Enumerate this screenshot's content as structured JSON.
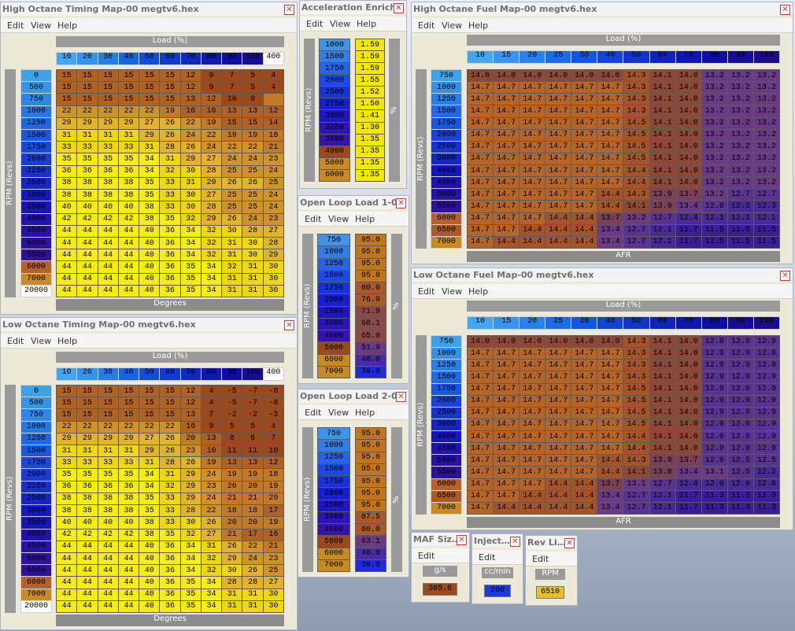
{
  "menu": {
    "edit": "Edit",
    "view": "View",
    "help": "Help"
  },
  "windows": {
    "hot": {
      "title": "High Octane Timing Map-00 megtv6.hex",
      "xlabel": "Load (%)",
      "ylabel": "RPM (Revs)",
      "footer": "Degrees",
      "cols": [
        "10",
        "20",
        "30",
        "40",
        "50",
        "60",
        "70",
        "80",
        "90",
        "100",
        "400"
      ],
      "rows": [
        "0",
        "500",
        "750",
        "1000",
        "1250",
        "1500",
        "1750",
        "2000",
        "2250",
        "2500",
        "3000",
        "3500",
        "4000",
        "4500",
        "5000",
        "5500",
        "6000",
        "7000",
        "20000"
      ],
      "cells": [
        [
          "15",
          "15",
          "15",
          "15",
          "15",
          "15",
          "12",
          "9",
          "7",
          "5",
          "4"
        ],
        [
          "15",
          "15",
          "15",
          "15",
          "15",
          "15",
          "12",
          "9",
          "7",
          "5",
          "4"
        ],
        [
          "15",
          "15",
          "15",
          "15",
          "15",
          "15",
          "13",
          "12",
          "10",
          "9"
        ],
        [
          "22",
          "22",
          "22",
          "22",
          "22",
          "19",
          "16",
          "16",
          "13",
          "13",
          "12"
        ],
        [
          "29",
          "29",
          "29",
          "29",
          "27",
          "26",
          "22",
          "19",
          "15",
          "15",
          "14"
        ],
        [
          "31",
          "31",
          "31",
          "31",
          "29",
          "26",
          "24",
          "22",
          "19",
          "19",
          "18"
        ],
        [
          "33",
          "33",
          "33",
          "33",
          "31",
          "28",
          "26",
          "24",
          "22",
          "22",
          "21"
        ],
        [
          "35",
          "35",
          "35",
          "35",
          "34",
          "31",
          "29",
          "27",
          "24",
          "24",
          "23"
        ],
        [
          "36",
          "36",
          "36",
          "36",
          "34",
          "32",
          "30",
          "28",
          "25",
          "25",
          "24"
        ],
        [
          "38",
          "38",
          "38",
          "38",
          "35",
          "33",
          "31",
          "29",
          "26",
          "26",
          "25"
        ],
        [
          "38",
          "38",
          "38",
          "38",
          "35",
          "33",
          "30",
          "27",
          "25",
          "25",
          "24"
        ],
        [
          "40",
          "40",
          "40",
          "40",
          "38",
          "33",
          "30",
          "28",
          "25",
          "25",
          "24"
        ],
        [
          "42",
          "42",
          "42",
          "42",
          "38",
          "35",
          "32",
          "29",
          "26",
          "24",
          "23"
        ],
        [
          "44",
          "44",
          "44",
          "44",
          "40",
          "36",
          "34",
          "32",
          "30",
          "28",
          "27"
        ],
        [
          "44",
          "44",
          "44",
          "44",
          "40",
          "36",
          "34",
          "32",
          "31",
          "30",
          "28"
        ],
        [
          "44",
          "44",
          "44",
          "44",
          "40",
          "36",
          "34",
          "32",
          "31",
          "30",
          "29"
        ],
        [
          "44",
          "44",
          "44",
          "44",
          "40",
          "36",
          "35",
          "34",
          "32",
          "31",
          "30"
        ],
        [
          "44",
          "44",
          "44",
          "44",
          "40",
          "36",
          "35",
          "34",
          "31",
          "31",
          "30"
        ],
        [
          "44",
          "44",
          "44",
          "44",
          "40",
          "36",
          "35",
          "34",
          "31",
          "31",
          "30"
        ]
      ]
    },
    "lot": {
      "title": "Low Octane Timing Map-00 megtv6.hex",
      "xlabel": "Load (%)",
      "ylabel": "RPM (Revs)",
      "footer": "Degrees",
      "cols": [
        "10",
        "20",
        "30",
        "40",
        "50",
        "60",
        "70",
        "80",
        "90",
        "100",
        "400"
      ],
      "rows": [
        "0",
        "500",
        "750",
        "1000",
        "1250",
        "1500",
        "1750",
        "2000",
        "2250",
        "2500",
        "3000",
        "3500",
        "4000",
        "4500",
        "5000",
        "5500",
        "6000",
        "7000",
        "20000"
      ],
      "cells": [
        [
          "15",
          "15",
          "15",
          "15",
          "15",
          "15",
          "12",
          "4",
          "-5",
          "-7",
          "-8"
        ],
        [
          "15",
          "15",
          "15",
          "15",
          "15",
          "15",
          "12",
          "4",
          "-5",
          "-7",
          "-8"
        ],
        [
          "15",
          "15",
          "15",
          "15",
          "15",
          "15",
          "13",
          "7",
          "-2",
          "-2",
          "-3"
        ],
        [
          "22",
          "22",
          "22",
          "22",
          "22",
          "22",
          "16",
          "9",
          "5",
          "5",
          "4"
        ],
        [
          "29",
          "29",
          "29",
          "29",
          "27",
          "26",
          "20",
          "13",
          "8",
          "8",
          "7"
        ],
        [
          "31",
          "31",
          "31",
          "31",
          "29",
          "26",
          "23",
          "16",
          "11",
          "11",
          "10"
        ],
        [
          "33",
          "33",
          "33",
          "33",
          "31",
          "28",
          "26",
          "19",
          "13",
          "13",
          "12"
        ],
        [
          "35",
          "35",
          "35",
          "35",
          "34",
          "31",
          "29",
          "24",
          "19",
          "19",
          "18"
        ],
        [
          "36",
          "36",
          "36",
          "36",
          "34",
          "32",
          "29",
          "23",
          "20",
          "20",
          "19"
        ],
        [
          "38",
          "38",
          "38",
          "38",
          "35",
          "33",
          "29",
          "24",
          "21",
          "21",
          "20"
        ],
        [
          "38",
          "38",
          "38",
          "38",
          "35",
          "33",
          "28",
          "22",
          "18",
          "18",
          "17"
        ],
        [
          "40",
          "40",
          "40",
          "40",
          "38",
          "33",
          "30",
          "26",
          "20",
          "20",
          "19"
        ],
        [
          "42",
          "42",
          "42",
          "42",
          "38",
          "35",
          "32",
          "27",
          "21",
          "17",
          "16"
        ],
        [
          "44",
          "44",
          "44",
          "44",
          "40",
          "36",
          "34",
          "31",
          "26",
          "22",
          "21"
        ],
        [
          "44",
          "44",
          "44",
          "44",
          "40",
          "36",
          "34",
          "32",
          "29",
          "24",
          "23"
        ],
        [
          "44",
          "44",
          "44",
          "44",
          "40",
          "36",
          "34",
          "32",
          "30",
          "26",
          "25"
        ],
        [
          "44",
          "44",
          "44",
          "44",
          "40",
          "36",
          "35",
          "34",
          "28",
          "28",
          "27"
        ],
        [
          "44",
          "44",
          "44",
          "44",
          "40",
          "36",
          "35",
          "34",
          "31",
          "31",
          "30"
        ],
        [
          "44",
          "44",
          "44",
          "44",
          "40",
          "36",
          "35",
          "34",
          "31",
          "31",
          "30"
        ]
      ]
    },
    "ae": {
      "title": "Acceleration Enrich…",
      "ylabel": "RPM (Revs)",
      "unit": "%",
      "rows": [
        "1000",
        "1500",
        "1750",
        "2000",
        "2500",
        "2750",
        "3000",
        "3250",
        "3500",
        "4000",
        "5000",
        "6000"
      ],
      "values": [
        "1.59",
        "1.59",
        "1.59",
        "1.55",
        "1.52",
        "1.50",
        "1.41",
        "1.30",
        "1.35",
        "1.35",
        "1.35",
        "1.35"
      ]
    },
    "ol1": {
      "title": "Open Loop Load 1-0…",
      "ylabel": "RPM (Revs)",
      "unit": "%",
      "rows": [
        "750",
        "1000",
        "1250",
        "1500",
        "1750",
        "2000",
        "2500",
        "3000",
        "4000",
        "5000",
        "6000",
        "7000"
      ],
      "values": [
        "95.0",
        "95.0",
        "95.0",
        "95.0",
        "80.0",
        "76.9",
        "71.9",
        "68.1",
        "65.0",
        "51.9",
        "40.0",
        "30.0"
      ]
    },
    "ol2": {
      "title": "Open Loop Load 2-0…",
      "ylabel": "RPM (Revs)",
      "unit": "%",
      "rows": [
        "750",
        "1000",
        "1250",
        "1500",
        "1750",
        "2000",
        "2500",
        "3000",
        "4000",
        "5000",
        "6000",
        "7000"
      ],
      "values": [
        "95.0",
        "95.0",
        "95.0",
        "95.0",
        "95.0",
        "95.0",
        "95.0",
        "87.5",
        "80.0",
        "63.1",
        "40.0",
        "30.0"
      ]
    },
    "hof": {
      "title": "High Octane Fuel Map-00 megtv6.hex",
      "xlabel": "Load (%)",
      "ylabel": "RPM (Revs)",
      "footer": "AFR",
      "cols": [
        "10",
        "15",
        "20",
        "25",
        "30",
        "40",
        "50",
        "60",
        "70",
        "80",
        "90",
        "100"
      ],
      "rows": [
        "750",
        "1000",
        "1250",
        "1500",
        "1750",
        "2000",
        "2500",
        "3000",
        "4000",
        "4500",
        "5000",
        "5500",
        "6000",
        "6500",
        "7000"
      ],
      "cells": [
        [
          "14.0",
          "14.0",
          "14.0",
          "14.0",
          "14.0",
          "14.0",
          "14.3",
          "14.1",
          "14.0",
          "13.2",
          "13.2",
          "13.2"
        ],
        [
          "14.7",
          "14.7",
          "14.7",
          "14.7",
          "14.7",
          "14.7",
          "14.3",
          "14.1",
          "14.0",
          "13.2",
          "13.2",
          "13.2"
        ],
        [
          "14.7",
          "14.7",
          "14.7",
          "14.7",
          "14.7",
          "14.7",
          "14.3",
          "14.1",
          "14.0",
          "13.2",
          "13.2",
          "13.2"
        ],
        [
          "14.7",
          "14.7",
          "14.7",
          "14.7",
          "14.7",
          "14.7",
          "14.3",
          "14.1",
          "14.0",
          "13.2",
          "13.2",
          "13.2"
        ],
        [
          "14.7",
          "14.7",
          "14.7",
          "14.7",
          "14.7",
          "14.7",
          "14.5",
          "14.1",
          "14.0",
          "13.2",
          "13.2",
          "13.2"
        ],
        [
          "14.7",
          "14.7",
          "14.7",
          "14.7",
          "14.7",
          "14.7",
          "14.5",
          "14.1",
          "14.0",
          "13.2",
          "13.2",
          "13.2"
        ],
        [
          "14.7",
          "14.7",
          "14.7",
          "14.7",
          "14.7",
          "14.7",
          "14.5",
          "14.1",
          "14.0",
          "13.2",
          "13.2",
          "13.2"
        ],
        [
          "14.7",
          "14.7",
          "14.7",
          "14.7",
          "14.7",
          "14.7",
          "14.5",
          "14.1",
          "14.0",
          "13.2",
          "13.2",
          "13.2"
        ],
        [
          "14.7",
          "14.7",
          "14.7",
          "14.7",
          "14.7",
          "14.7",
          "14.4",
          "14.1",
          "14.0",
          "13.2",
          "13.2",
          "13.2"
        ],
        [
          "14.7",
          "14.7",
          "14.7",
          "14.7",
          "14.7",
          "14.7",
          "14.4",
          "14.1",
          "14.0",
          "13.2",
          "13.2",
          "13.2"
        ],
        [
          "14.7",
          "14.7",
          "14.7",
          "14.7",
          "14.7",
          "14.4",
          "14.3",
          "13.9",
          "13.7",
          "13.2",
          "12.7",
          "12.7"
        ],
        [
          "14.7",
          "14.7",
          "14.7",
          "14.7",
          "14.7",
          "14.4",
          "14.1",
          "13.9",
          "13.4",
          "12.6",
          "12.3",
          "12.3"
        ],
        [
          "14.7",
          "14.7",
          "14.7",
          "14.4",
          "14.4",
          "13.7",
          "13.2",
          "12.7",
          "12.4",
          "12.1",
          "12.1",
          "12.1"
        ],
        [
          "14.7",
          "14.7",
          "14.4",
          "14.4",
          "14.4",
          "13.4",
          "12.7",
          "12.1",
          "11.7",
          "11.5",
          "11.5",
          "11.5"
        ],
        [
          "14.7",
          "14.4",
          "14.4",
          "14.4",
          "14.4",
          "13.4",
          "12.7",
          "12.1",
          "11.7",
          "11.5",
          "11.5",
          "11.5"
        ]
      ]
    },
    "lof": {
      "title": "Low Octane Fuel Map-00 megtv6.hex",
      "xlabel": "Load (%)",
      "ylabel": "RPM (Revs)",
      "footer": "AFR",
      "cols": [
        "10",
        "15",
        "20",
        "25",
        "30",
        "40",
        "50",
        "60",
        "70",
        "80",
        "90",
        "100"
      ],
      "rows": [
        "750",
        "1000",
        "1250",
        "1500",
        "1750",
        "2000",
        "2500",
        "3000",
        "4000",
        "4500",
        "5000",
        "5500",
        "6000",
        "6500",
        "7000"
      ],
      "cells": [
        [
          "14.0",
          "14.0",
          "14.0",
          "14.0",
          "14.0",
          "14.0",
          "14.3",
          "14.1",
          "14.0",
          "12.9",
          "12.9",
          "12.9"
        ],
        [
          "14.7",
          "14.7",
          "14.7",
          "14.7",
          "14.7",
          "14.7",
          "14.3",
          "14.1",
          "14.0",
          "12.9",
          "12.9",
          "12.9"
        ],
        [
          "14.7",
          "14.7",
          "14.7",
          "14.7",
          "14.7",
          "14.7",
          "14.3",
          "14.1",
          "14.0",
          "12.9",
          "12.9",
          "12.9"
        ],
        [
          "14.7",
          "14.7",
          "14.7",
          "14.7",
          "14.7",
          "14.7",
          "14.3",
          "14.1",
          "14.0",
          "12.9",
          "12.9",
          "12.9"
        ],
        [
          "14.7",
          "14.7",
          "14.7",
          "14.7",
          "14.7",
          "14.7",
          "14.5",
          "14.1",
          "14.0",
          "12.9",
          "12.9",
          "12.9"
        ],
        [
          "14.7",
          "14.7",
          "14.7",
          "14.7",
          "14.7",
          "14.7",
          "14.5",
          "14.1",
          "14.0",
          "12.9",
          "12.9",
          "12.9"
        ],
        [
          "14.7",
          "14.7",
          "14.7",
          "14.7",
          "14.7",
          "14.7",
          "14.5",
          "14.1",
          "14.0",
          "12.9",
          "12.9",
          "12.9"
        ],
        [
          "14.7",
          "14.7",
          "14.7",
          "14.7",
          "14.7",
          "14.7",
          "14.5",
          "14.1",
          "14.0",
          "12.9",
          "12.9",
          "12.9"
        ],
        [
          "14.7",
          "14.7",
          "14.7",
          "14.7",
          "14.7",
          "14.7",
          "14.4",
          "14.1",
          "14.0",
          "12.9",
          "12.9",
          "12.9"
        ],
        [
          "14.7",
          "14.7",
          "14.7",
          "14.7",
          "14.7",
          "14.7",
          "14.4",
          "14.1",
          "14.0",
          "12.9",
          "12.9",
          "12.9"
        ],
        [
          "14.7",
          "14.7",
          "14.7",
          "14.7",
          "14.7",
          "14.4",
          "14.3",
          "13.9",
          "13.7",
          "12.9",
          "12.5",
          "12.5"
        ],
        [
          "14.7",
          "14.7",
          "14.7",
          "14.7",
          "14.7",
          "14.4",
          "14.1",
          "13.8",
          "13.4",
          "13.1",
          "12.5",
          "12.2"
        ],
        [
          "14.7",
          "14.7",
          "14.7",
          "14.4",
          "14.4",
          "13.7",
          "13.1",
          "12.7",
          "12.4",
          "12.0",
          "12.0",
          "12.0"
        ],
        [
          "14.7",
          "14.7",
          "14.4",
          "14.4",
          "14.4",
          "13.4",
          "12.7",
          "12.1",
          "11.7",
          "11.3",
          "11.3",
          "11.3"
        ],
        [
          "14.7",
          "14.4",
          "14.4",
          "14.4",
          "14.4",
          "13.4",
          "12.7",
          "12.1",
          "11.7",
          "11.3",
          "11.3",
          "11.3"
        ]
      ]
    },
    "maf": {
      "title": "MAF Siz…",
      "unit": "g/s",
      "value": "305.6"
    },
    "inj": {
      "title": "Inject…",
      "unit": "cc/min",
      "value": "260"
    },
    "rev": {
      "title": "Rev Li…",
      "unit": "RPM",
      "value": "6510"
    }
  },
  "colors": {
    "header_blue": "#1f5ee8",
    "cell_yellow": "#f2e800",
    "cell_orange": "#c88a22",
    "cell_brown": "#9c4a1c",
    "cell_purple": "#6a3a8c",
    "deep_purple": "#3a1a8a"
  }
}
